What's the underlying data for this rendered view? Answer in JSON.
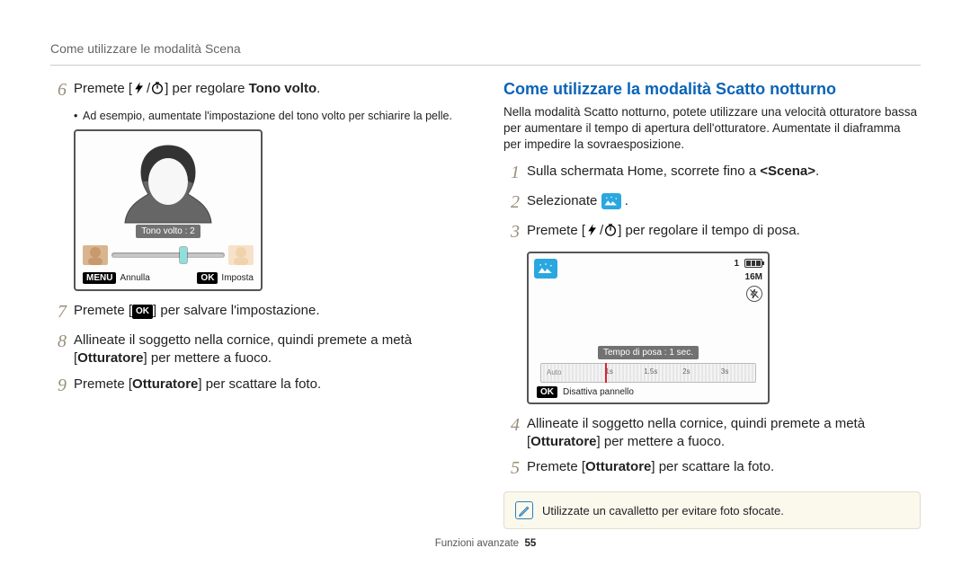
{
  "header": {
    "title": "Come utilizzare le modalità Scena"
  },
  "left": {
    "steps": {
      "s6": {
        "num": "6",
        "prefix": "Premete [",
        "mid": "] per regolare ",
        "bold": "Tono volto",
        "suffix": "."
      },
      "s6_sub": "Ad esempio, aumentate l'impostazione del tono volto per schiarire la pelle.",
      "s7": {
        "num": "7",
        "text_a": "Premete [",
        "text_b": "] per salvare l'impostazione."
      },
      "s8": {
        "num": "8",
        "line1": "Allineate il soggetto nella cornice, quindi premete a metà ",
        "line2_a": "[",
        "line2_bold": "Otturatore",
        "line2_b": "] per mettere a fuoco."
      },
      "s9": {
        "num": "9",
        "a": "Premete [",
        "bold": "Otturatore",
        "b": "] per scattare la foto."
      }
    },
    "screenshot": {
      "tone_label": "Tono volto : 2",
      "menu_btn": "MENU",
      "menu_text": "Annulla",
      "ok_btn": "OK",
      "ok_text": "Imposta"
    }
  },
  "right": {
    "title": "Come utilizzare la modalità Scatto notturno",
    "intro": "Nella modalità Scatto notturno, potete utilizzare una velocità otturatore bassa per aumentare il tempo di apertura dell'otturatore. Aumentate il diaframma per impedire la sovraesposizione.",
    "steps": {
      "s1": {
        "num": "1",
        "a": "Sulla schermata Home, scorrete fino a ",
        "bold": "<Scena>",
        "b": "."
      },
      "s2": {
        "num": "2",
        "a": "Selezionate "
      },
      "s3": {
        "num": "3",
        "a": "Premete [",
        "b": "] per regolare il tempo di posa."
      },
      "s4": {
        "num": "4",
        "line1": "Allineate il soggetto nella cornice, quindi premete a metà ",
        "line2_a": "[",
        "line2_bold": "Otturatore",
        "line2_b": "] per mettere a fuoco."
      },
      "s5": {
        "num": "5",
        "a": "Premete [",
        "bold": "Otturatore",
        "b": "] per scattare la foto."
      }
    },
    "screenshot": {
      "shots": "1",
      "res": "16M",
      "timing_label": "Tempo di posa : 1 sec.",
      "ruler": {
        "auto": "Auto",
        "t1": "1s",
        "t15": "1.5s",
        "t2": "2s",
        "t3": "3s"
      },
      "ok_btn": "OK",
      "ok_text": "Disattiva pannello"
    },
    "tip": "Utilizzate un cavalletto per evitare foto sfocate."
  },
  "footer": {
    "label": "Funzioni avanzate",
    "page": "55"
  }
}
